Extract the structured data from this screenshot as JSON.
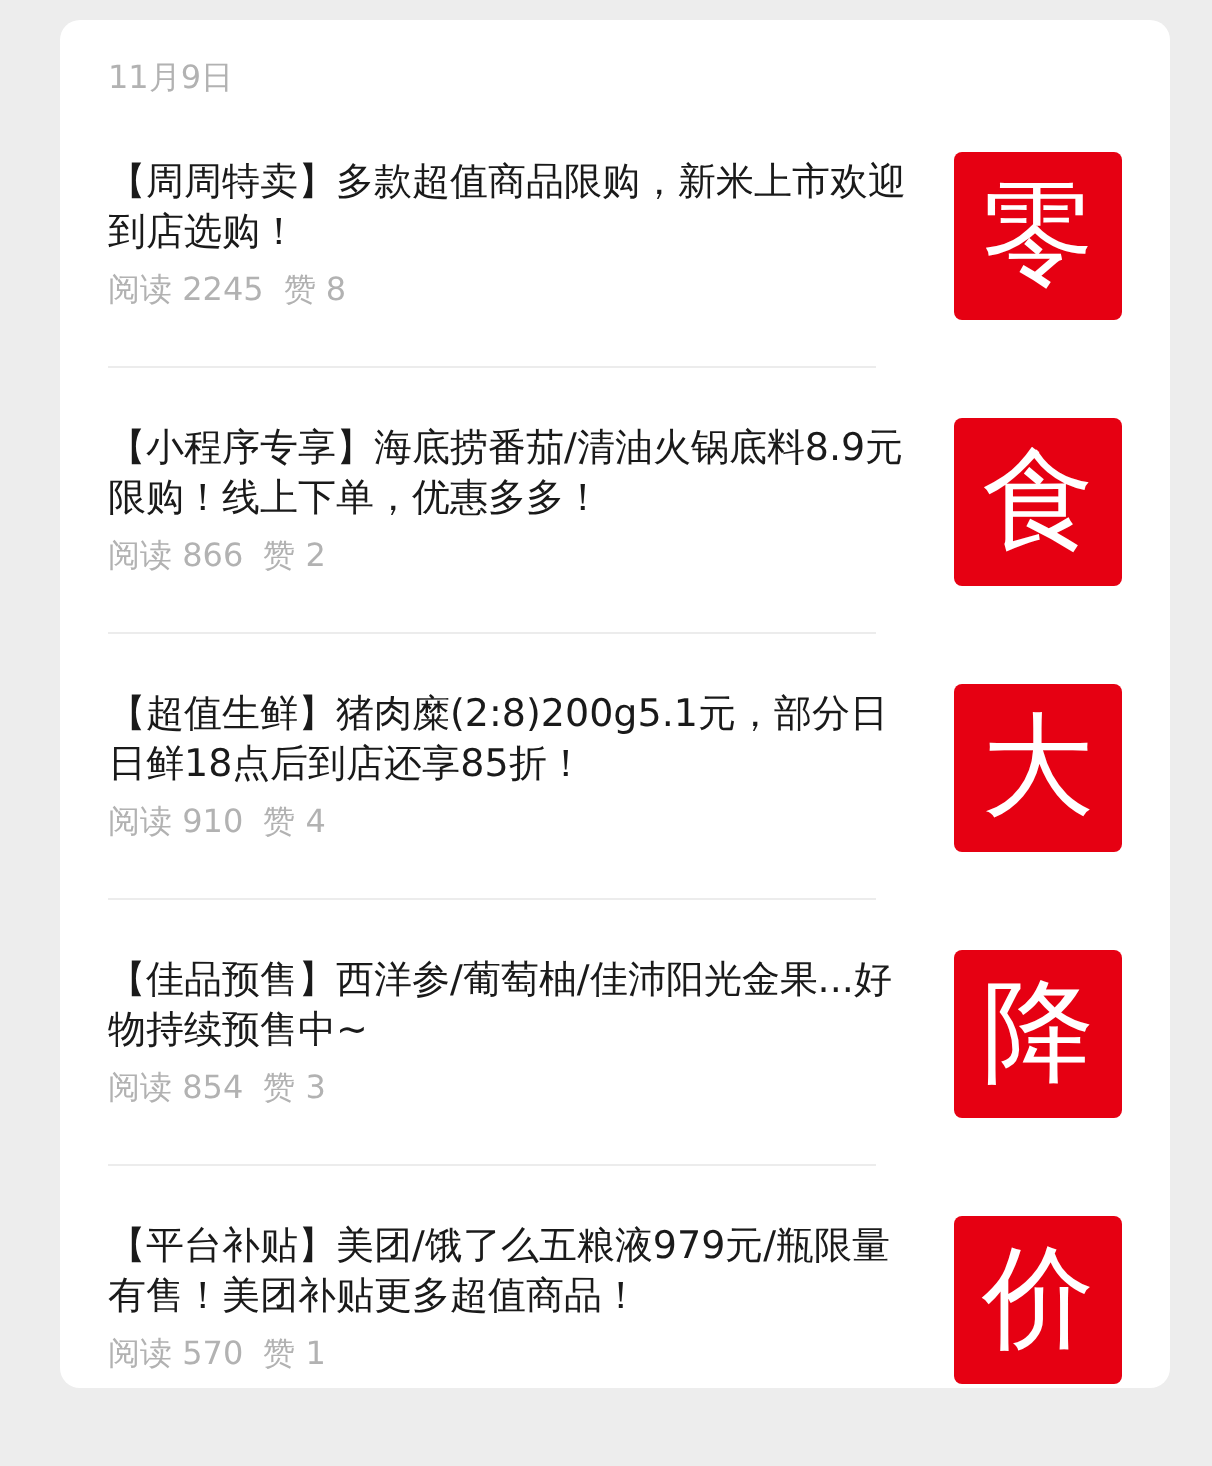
{
  "date": "11月9日",
  "articles": [
    {
      "title": "【周周特卖】多款超值商品限购，新米上市欢迎到店选购！",
      "reads": "阅读 2245",
      "likes": "赞 8",
      "cover": "零"
    },
    {
      "title": "【小程序专享】海底捞番茄/清油火锅底料8.9元限购！线上下单，优惠多多！",
      "reads": "阅读 866",
      "likes": "赞 2",
      "cover": "食"
    },
    {
      "title": "【超值生鲜】猪肉糜(2:8)200g5.1元，部分日日鲜18点后到店还享85折！",
      "reads": "阅读 910",
      "likes": "赞 4",
      "cover": "大"
    },
    {
      "title": "【佳品预售】西洋参/葡萄柚/佳沛阳光金果...好物持续预售中~",
      "reads": "阅读 854",
      "likes": "赞 3",
      "cover": "降"
    },
    {
      "title": "【平台补贴】美团/饿了么五粮液979元/瓶限量有售！美团补贴更多超值商品！",
      "reads": "阅读 570",
      "likes": "赞 1",
      "cover": "价"
    }
  ]
}
